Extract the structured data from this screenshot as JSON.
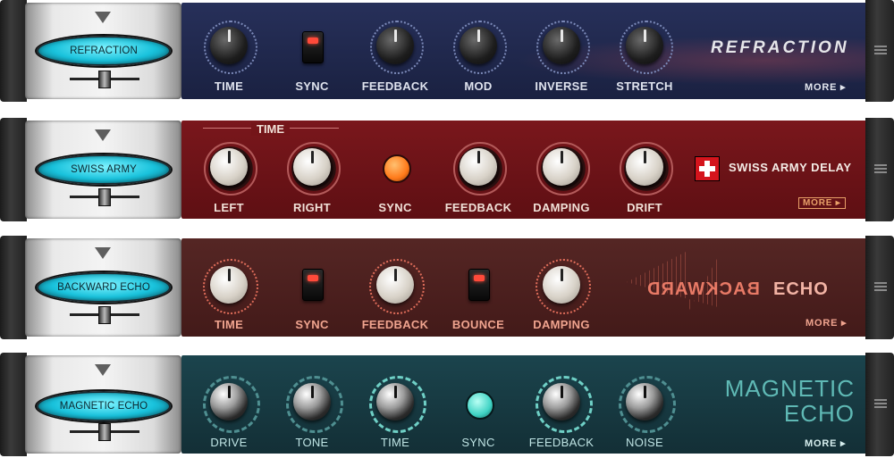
{
  "racks": [
    {
      "preset_name": "REFRACTION",
      "brand_text": "REFRACTION",
      "more_label": "MORE ▸",
      "controls": [
        "TIME",
        "SYNC",
        "FEEDBACK",
        "MOD",
        "INVERSE",
        "STRETCH"
      ],
      "colors": {
        "face": "#1e2646",
        "label": "#dfe3ee"
      }
    },
    {
      "preset_name": "SWISS ARMY",
      "brand_text": "SWISS ARMY DELAY",
      "group_label": "TIME",
      "more_label": "MORE ▸",
      "controls": [
        "LEFT",
        "RIGHT",
        "SYNC",
        "FEEDBACK",
        "DAMPING",
        "DRIFT"
      ],
      "colors": {
        "face": "#6e1216",
        "label": "#f1e1d8"
      }
    },
    {
      "preset_name": "BACKWARD ECHO",
      "brand_text_reversed": "BACKWARD",
      "brand_text": "ECHO",
      "more_label": "MORE ▸",
      "controls": [
        "TIME",
        "SYNC",
        "FEEDBACK",
        "BOUNCE",
        "DAMPING"
      ],
      "colors": {
        "face": "#4a1f1e",
        "label": "#f0a48f"
      }
    },
    {
      "preset_name": "MAGNETIC ECHO",
      "brand_line1": "MAGNETIC",
      "brand_line2": "ECHO",
      "more_label": "MORE ▸",
      "controls": [
        "DRIVE",
        "TONE",
        "TIME",
        "SYNC",
        "FEEDBACK",
        "NOISE"
      ],
      "colors": {
        "face": "#173a42",
        "label": "#bfe4e4"
      }
    }
  ]
}
